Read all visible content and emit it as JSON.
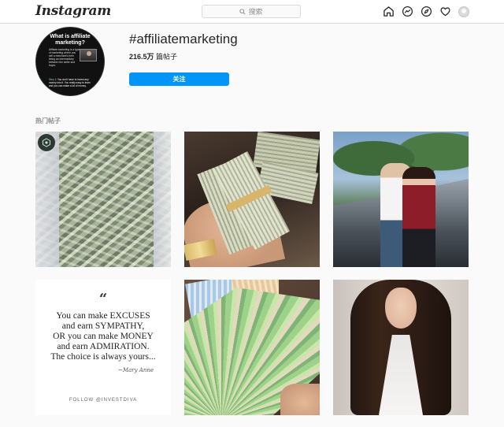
{
  "app": {
    "logo": "Instagram"
  },
  "search": {
    "placeholder": "搜索"
  },
  "nav": {
    "icons": [
      "home-icon",
      "messenger-icon",
      "explore-icon",
      "heart-icon",
      "profile-avatar"
    ]
  },
  "header": {
    "hashtag": "#affiliatemarketing",
    "post_count": "216.5万",
    "post_count_label": " 篇帖子",
    "follow_label": "关注",
    "profile_image_text": {
      "title": "What is affiliate marketing?",
      "body": "Affiliate marketing is a type of marketing where you sell a merchant's item being an intermediary between the seller and buyer.",
      "foot_a": "Step ",
      "foot_b": "1",
      "foot_c": ": You don't have to invest any money into it. You really easy to learn and you can make a lot of money."
    }
  },
  "section": {
    "top_posts_label": "热门帖子"
  },
  "posts": [
    {
      "alt": "pile of cash in bag",
      "reel": true
    },
    {
      "alt": "hand holding stacks of money"
    },
    {
      "alt": "couple with sports car"
    },
    {
      "alt": "quote card",
      "quote_mark": "“",
      "quote_lines": [
        "You can make EXCUSES",
        "and earn SYMPATHY,",
        "OR you can make MONEY",
        "and earn ADMIRATION.",
        "The choice is always yours..."
      ],
      "signature": "~Mary Anne",
      "footer": "FOLLOW @INVESTDIVA"
    },
    {
      "alt": "fan of euro banknotes"
    },
    {
      "alt": "woman with long dark hair"
    }
  ],
  "colors": {
    "accent": "#0095f6",
    "border": "#dbdbdb",
    "muted": "#8e8e8e"
  }
}
